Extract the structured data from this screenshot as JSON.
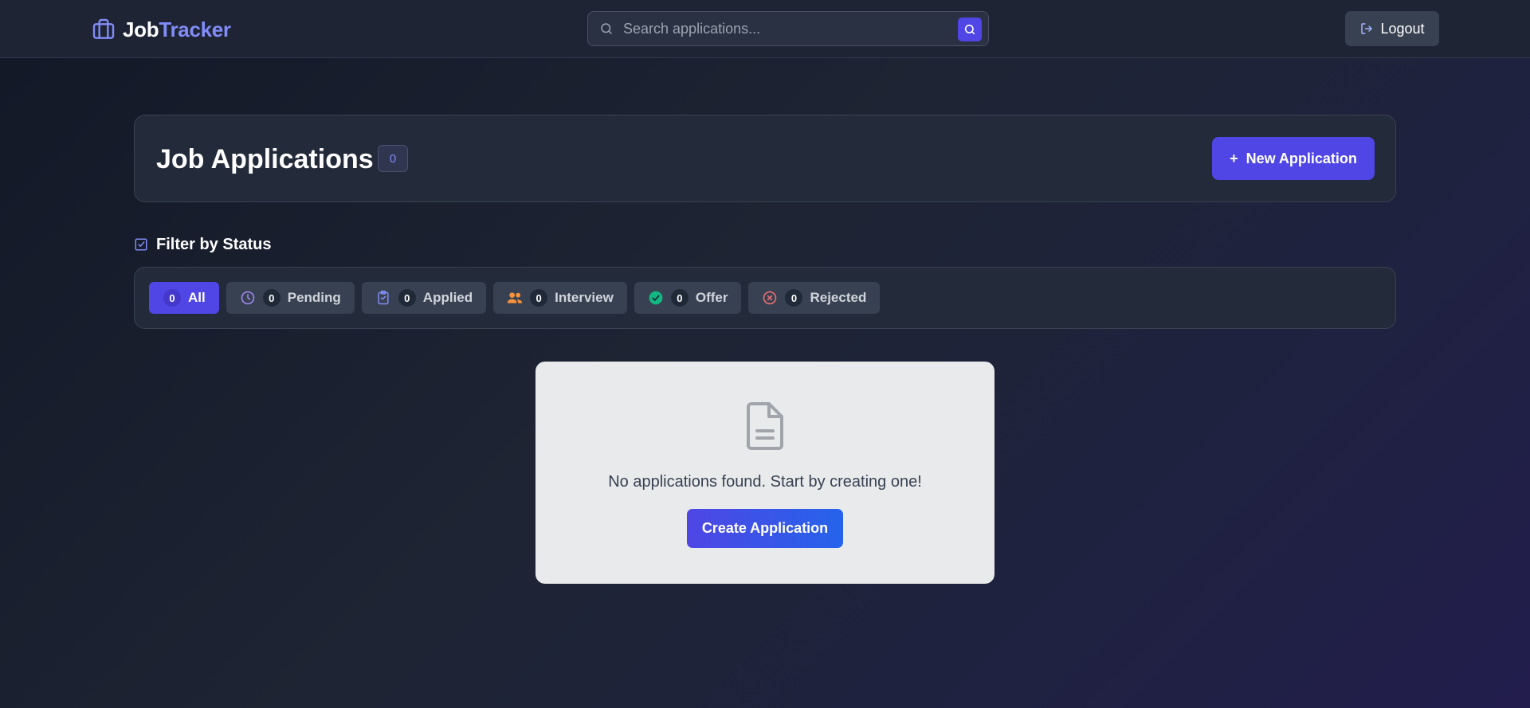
{
  "brand": {
    "part1": "Job",
    "part2": "Tracker",
    "icon": "briefcase-icon"
  },
  "search": {
    "placeholder": "Search applications...",
    "value": ""
  },
  "header": {
    "logout_label": "Logout"
  },
  "main": {
    "title": "Job Applications",
    "count": "0",
    "new_button_label": "New Application",
    "new_button_icon": "+"
  },
  "filter": {
    "heading": "Filter by Status",
    "chips": [
      {
        "label": "All",
        "count": "0",
        "icon": "none",
        "active": true
      },
      {
        "label": "Pending",
        "count": "0",
        "icon": "clock-icon"
      },
      {
        "label": "Applied",
        "count": "0",
        "icon": "clipboard-icon"
      },
      {
        "label": "Interview",
        "count": "0",
        "icon": "users-icon"
      },
      {
        "label": "Offer",
        "count": "0",
        "icon": "check-circle-icon"
      },
      {
        "label": "Rejected",
        "count": "0",
        "icon": "x-circle-icon"
      }
    ]
  },
  "empty_state": {
    "message": "No applications found. Start by creating one!",
    "button_label": "Create Application",
    "icon": "document-icon"
  },
  "colors": {
    "accent": "#4f46e5",
    "brand_secondary": "#818cf8",
    "offer": "#10b981",
    "rejected": "#f87171",
    "interview": "#fb923c"
  }
}
